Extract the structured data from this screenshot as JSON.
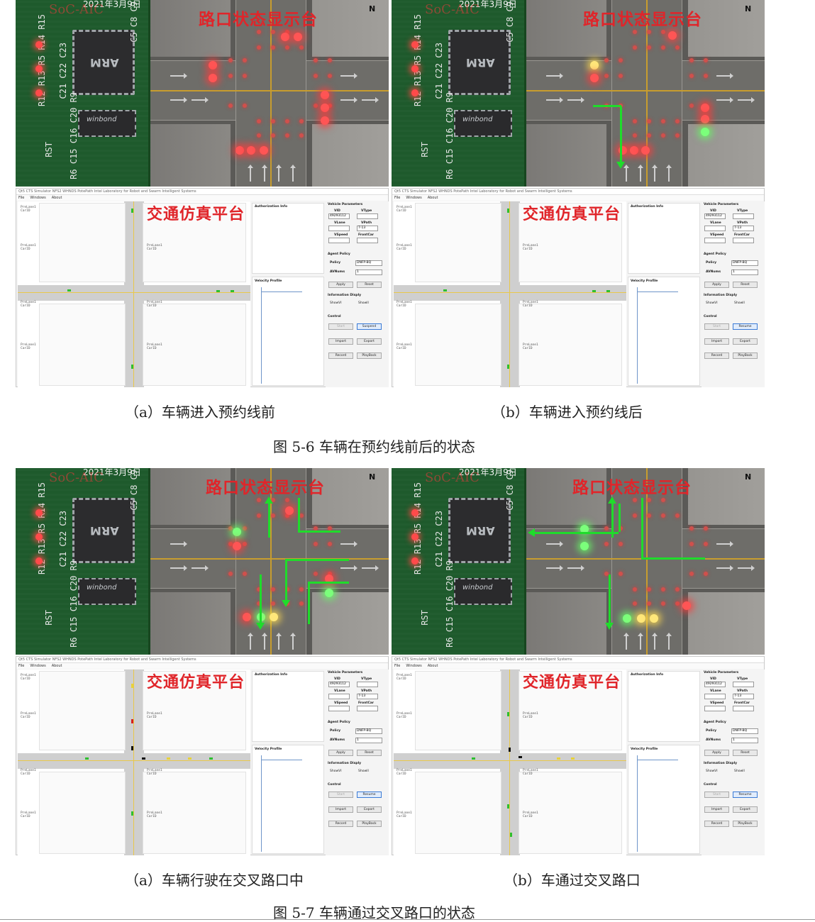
{
  "figures": [
    {
      "caption": "图 5-6 车辆在预约线前后的状态",
      "panels": [
        {
          "subcaption": "（a）车辆进入预约线前",
          "board_title": "路口状态显示台",
          "board_date": "2021年3月9日",
          "north": "N",
          "sim_title": "交通仿真平台",
          "control_button": "Suspend",
          "dir_arrows": []
        },
        {
          "subcaption": "（b）车辆进入预约线后",
          "board_title": "路口状态显示台",
          "board_date": "2021年3月9日",
          "north": "N",
          "sim_title": "交通仿真平台",
          "control_button": "Resume",
          "dir_arrows": [
            "south"
          ]
        }
      ]
    },
    {
      "caption": "图 5-7 车辆通过交叉路口的状态",
      "panels": [
        {
          "subcaption": "（a）车辆行驶在交叉路口中",
          "board_title": "路口状态显示台",
          "board_date": "2021年3月9日",
          "north": "N",
          "sim_title": "交通仿真平台",
          "control_button": "Resume",
          "dir_arrows": [
            "north-east",
            "east",
            "south"
          ]
        },
        {
          "subcaption": "（b）车通过交叉路口",
          "board_title": "路口状态显示台",
          "board_date": "2021年3月9日",
          "north": "N",
          "sim_title": "交通仿真平台",
          "control_button": "Resume",
          "dir_arrows": [
            "north-west",
            "north-east",
            "south"
          ]
        }
      ]
    }
  ],
  "sim_ui": {
    "window_title": "Qt5 CTS Simulator        NFS2 WHNDS PotePath Intel Laboratory for Robot and Swarm Intelligent Systems",
    "menu": [
      "File",
      "Windows",
      "About"
    ],
    "authorization_label": "Authorization Info",
    "velocity_label": "Velocity Profile",
    "vehicle_params_label": "Vehicle Parameters",
    "vid_label": "VID",
    "vtype_label": "VType",
    "vlane_label": "VLane",
    "vpath_label": "VPath",
    "vspeed_label": "VSpeed",
    "frontcar_label": "FrontCar",
    "vid_value": "49293112",
    "vpath_value": "7-13",
    "agent_policy_label": "Agent Policy",
    "policy_label": "Policy",
    "policy_value": "DNFP-BQ",
    "avnums_label": "AVNums",
    "avnums_value": "1",
    "apply": "Apply",
    "reset": "Reset",
    "info_display_label": "Information Disply",
    "show_vi": "ShowVI",
    "show_ii": "ShowII",
    "control_label": "Control",
    "start": "Start",
    "import": "Import",
    "export": "Export",
    "record": "Record",
    "playback": "PlayBack"
  }
}
